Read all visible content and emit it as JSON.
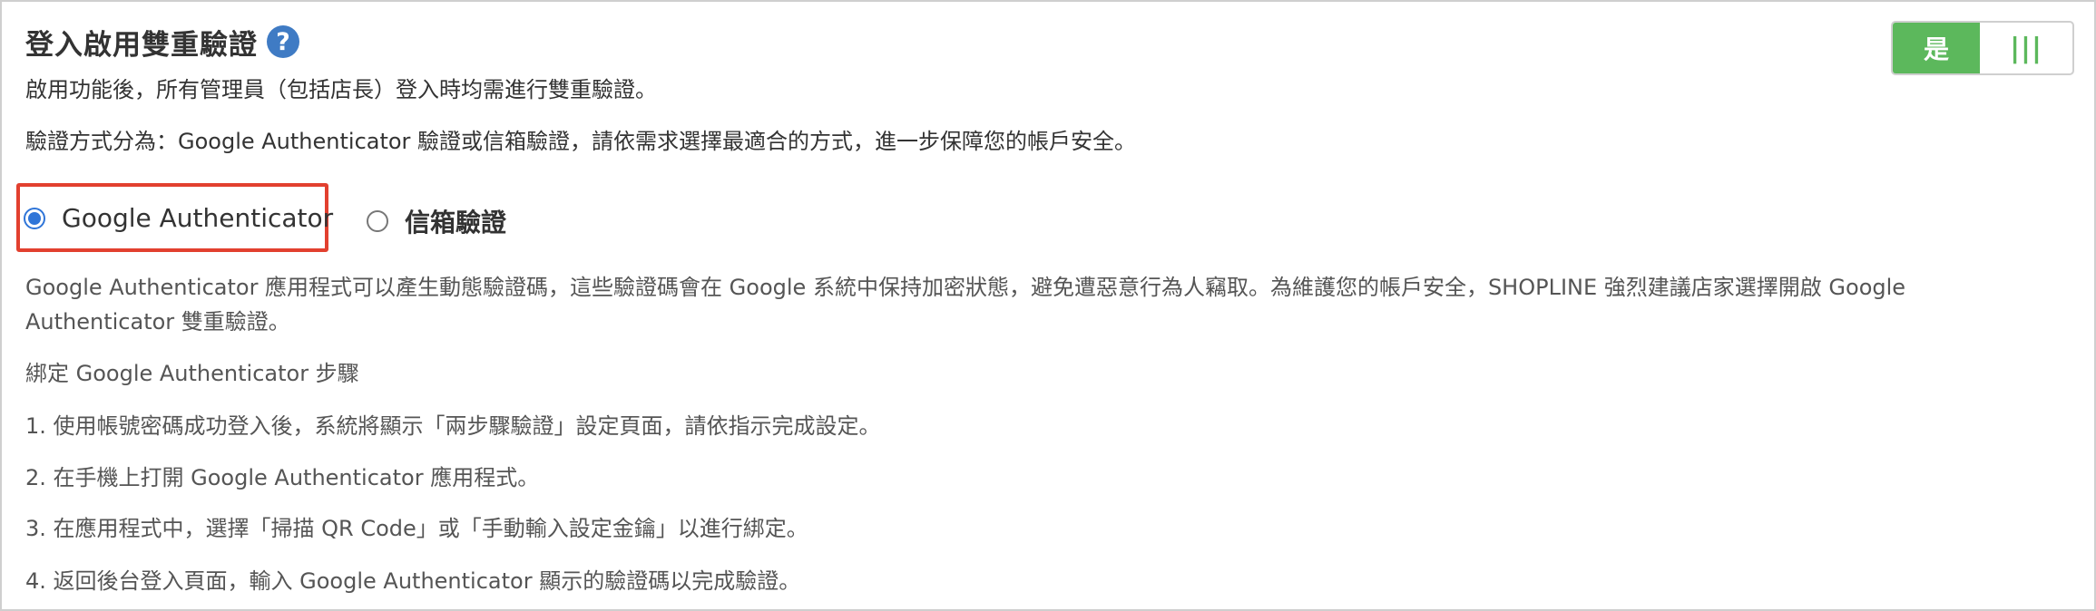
{
  "header": {
    "title": "登入啟用雙重驗證",
    "help_icon": "question-circle-icon",
    "subtitle": "啟用功能後，所有管理員（包括店長）登入時均需進行雙重驗證。",
    "methods_text": "驗證方式分為：Google Authenticator 驗證或信箱驗證，請依需求選擇最適合的方式，進一步保障您的帳戶安全。"
  },
  "toggle": {
    "on_label": "是",
    "handle_glyph": "|||",
    "state": "on",
    "accent_color": "#5cb85c"
  },
  "options": {
    "google_label": "Google Authenticator",
    "email_label": "信箱驗證",
    "selected": "google",
    "highlight_color": "#e2402f",
    "radio_color": "#2f75d8"
  },
  "content": {
    "description": "Google Authenticator 應用程式可以產生動態驗證碼，這些驗證碼會在 Google 系統中保持加密狀態，避免遭惡意行為人竊取。為維護您的帳戶安全，SHOPLINE 強烈建議店家選擇開啟 Google Authenticator 雙重驗證。",
    "steps_title": "綁定 Google Authenticator 步驟",
    "steps": [
      "1. 使用帳號密碼成功登入後，系統將顯示「兩步驟驗證」設定頁面，請依指示完成設定。",
      "2. 在手機上打開 Google Authenticator 應用程式。",
      "3. 在應用程式中，選擇「掃描 QR Code」或「手動輸入設定金鑰」以進行綁定。",
      "4. 返回後台登入頁面，輸入 Google Authenticator 顯示的驗證碼以完成驗證。"
    ]
  }
}
